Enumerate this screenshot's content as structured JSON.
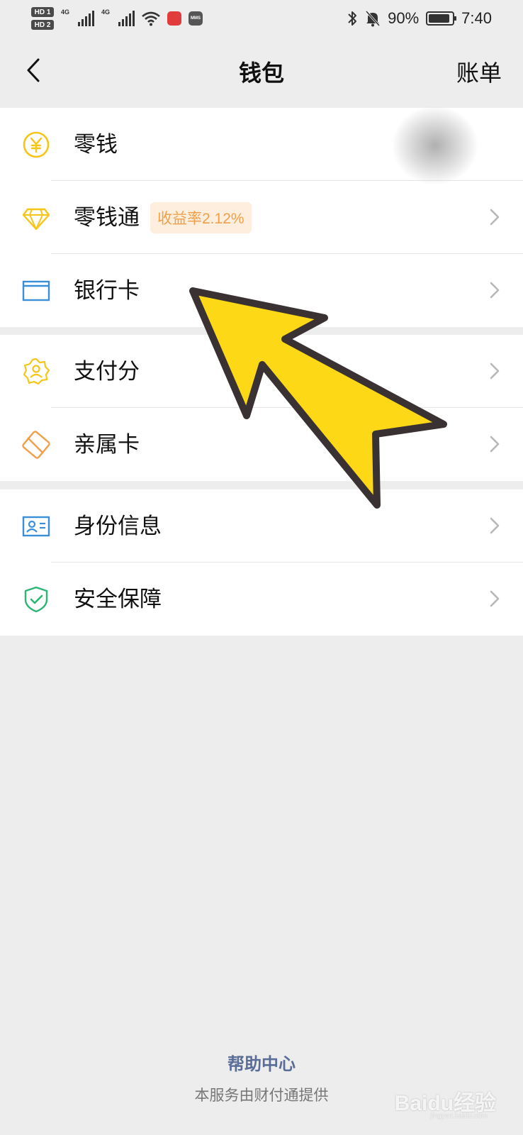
{
  "status_bar": {
    "hd1": "HD 1",
    "hd2": "HD 2",
    "network1": "4G",
    "network2": "4G",
    "battery_percent": "90%",
    "battery_level": 0.9,
    "time": "7:40",
    "mms_label": "MMS"
  },
  "nav": {
    "title": "钱包",
    "right_action": "账单"
  },
  "sections": [
    {
      "rows": [
        {
          "label": "零钱",
          "icon": "yuan-coin-icon",
          "icon_color": "#f5c518",
          "has_chevron": false
        },
        {
          "label": "零钱通",
          "icon": "diamond-icon",
          "icon_color": "#f5c518",
          "badge": "收益率2.12%",
          "has_chevron": true
        },
        {
          "label": "银行卡",
          "icon": "bank-card-icon",
          "icon_color": "#3a8fd8",
          "has_chevron": true
        }
      ]
    },
    {
      "rows": [
        {
          "label": "支付分",
          "icon": "pay-score-icon",
          "icon_color": "#f5c518",
          "has_chevron": true
        },
        {
          "label": "亲属卡",
          "icon": "family-card-icon",
          "icon_color": "#f0a04a",
          "has_chevron": true
        }
      ]
    },
    {
      "rows": [
        {
          "label": "身份信息",
          "icon": "id-card-icon",
          "icon_color": "#3a8fd8",
          "has_chevron": true
        },
        {
          "label": "安全保障",
          "icon": "shield-check-icon",
          "icon_color": "#2bb673",
          "has_chevron": true
        }
      ]
    }
  ],
  "footer": {
    "help": "帮助中心",
    "provider": "本服务由财付通提供"
  },
  "watermark": {
    "brand": "Baidu经验",
    "url": "jingyan.baidu.com"
  },
  "overlay": {
    "arrow_color": "#fdd817",
    "arrow_outline": "#3a3232"
  }
}
